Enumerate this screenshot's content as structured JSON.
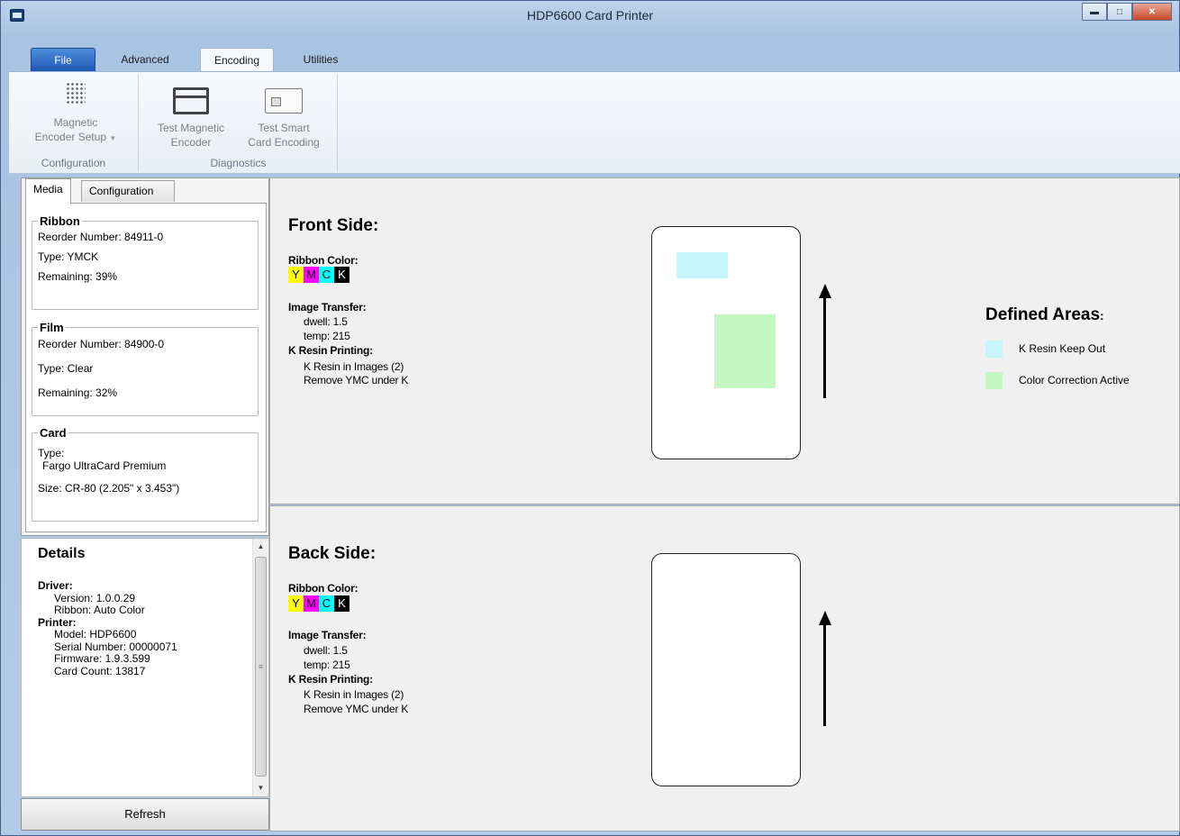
{
  "window": {
    "title": "HDP6600 Card Printer"
  },
  "ribbon": {
    "tabs": {
      "file": "File",
      "advanced": "Advanced",
      "encoding": "Encoding",
      "utilities": "Utilities"
    },
    "groups": {
      "configuration": {
        "label": "Configuration",
        "magnetic_encoder_setup": [
          "Magnetic",
          "Encoder Setup"
        ]
      },
      "diagnostics": {
        "label": "Diagnostics",
        "test_magnetic_encoder": [
          "Test Magnetic",
          "Encoder"
        ],
        "test_smart_card": [
          "Test Smart",
          "Card Encoding"
        ]
      }
    }
  },
  "left_panel": {
    "tabs": {
      "media": "Media",
      "configuration": "Configuration"
    },
    "ribbon": {
      "legend": "Ribbon",
      "reorder": "Reorder Number: 84911-0",
      "type": "Type: YMCK",
      "remaining": "Remaining: 39%"
    },
    "film": {
      "legend": "Film",
      "reorder": "Reorder Number: 84900-0",
      "type": "Type: Clear",
      "remaining": "Remaining: 32%"
    },
    "card": {
      "legend": "Card",
      "type_label": "Type:",
      "type_value": "Fargo UltraCard Premium",
      "size": "Size: CR-80 (2.205\" x 3.453\")"
    }
  },
  "details": {
    "title": "Details",
    "driver_label": "Driver:",
    "driver_version": "Version: 1.0.0.29",
    "driver_ribbon": "Ribbon: Auto Color",
    "printer_label": "Printer:",
    "model": "Model: HDP6600",
    "serial": "Serial Number: 00000071",
    "firmware": "Firmware: 1.9.3.599",
    "card_count": "Card Count: 13817",
    "refresh_label": "Refresh"
  },
  "front": {
    "title": "Front Side:",
    "ribbon_color_label": "Ribbon Color:",
    "chips": [
      "Y",
      "M",
      "C",
      "K"
    ],
    "image_transfer_label": "Image Transfer:",
    "dwell": "dwell: 1.5",
    "temp": "temp: 215",
    "k_resin_label": "K Resin Printing:",
    "k_resin_images": "K Resin in Images (2)",
    "remove_ymc": "Remove YMC under K"
  },
  "back": {
    "title": "Back Side:",
    "ribbon_color_label": "Ribbon Color:",
    "chips": [
      "Y",
      "M",
      "C",
      "K"
    ],
    "image_transfer_label": "Image Transfer:",
    "dwell": "dwell: 1.5",
    "temp": "temp: 215",
    "k_resin_label": "K Resin Printing:",
    "k_resin_images": "K Resin in Images (2)",
    "remove_ymc": "Remove YMC under K"
  },
  "defined_areas": {
    "title": "Defined Areas",
    "title_suffix": ":",
    "items": [
      {
        "label": "K Resin Keep Out",
        "color": "#c6f5fb"
      },
      {
        "label": "Color Correction Active",
        "color": "#c3f8c3"
      }
    ]
  },
  "colors": {
    "yellow": "#ffff00",
    "magenta": "#ff00ff",
    "cyan": "#00ffff",
    "black": "#000000",
    "window_accent": "#1f57b6"
  }
}
